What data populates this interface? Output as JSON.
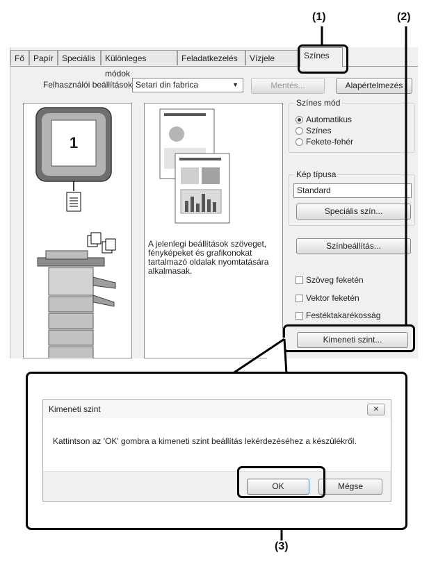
{
  "callouts": {
    "one": "(1)",
    "two": "(2)",
    "three": "(3)"
  },
  "tabs": [
    "Fő",
    "Papír",
    "Speciális",
    "Különleges módok",
    "Feladatkezelés",
    "Vízjele",
    "Színes"
  ],
  "settings_row": {
    "label": "Felhasználói beállítások:",
    "combo_value": "Setari din fabrica",
    "save_label": "Mentés...",
    "default_label": "Alapértelmezés"
  },
  "preview": {
    "page_number": "1",
    "description": "A jelenlegi beállítások szöveget, fényképeket és grafikonokat tartalmazó oldalak nyomtatására alkalmasak."
  },
  "color_mode": {
    "title": "Színes mód",
    "options": [
      "Automatikus",
      "Színes",
      "Fekete-fehér"
    ],
    "selected": "Automatikus"
  },
  "image_type": {
    "title": "Kép típusa",
    "value": "Standard",
    "special_color_button": "Speciális szín..."
  },
  "color_settings_button": "Színbeállítás...",
  "checkboxes": [
    "Szöveg feketén",
    "Vektor feketén",
    "Festéktakarékosság"
  ],
  "output_level_button": "Kimeneti szint...",
  "modal": {
    "title": "Kimeneti szint",
    "message": "Kattintson az 'OK' gombra a kimeneti szint beállítás lekérdezéséhez a készülékről.",
    "ok_label": "OK",
    "cancel_label": "Mégse",
    "close_label": "✕"
  }
}
